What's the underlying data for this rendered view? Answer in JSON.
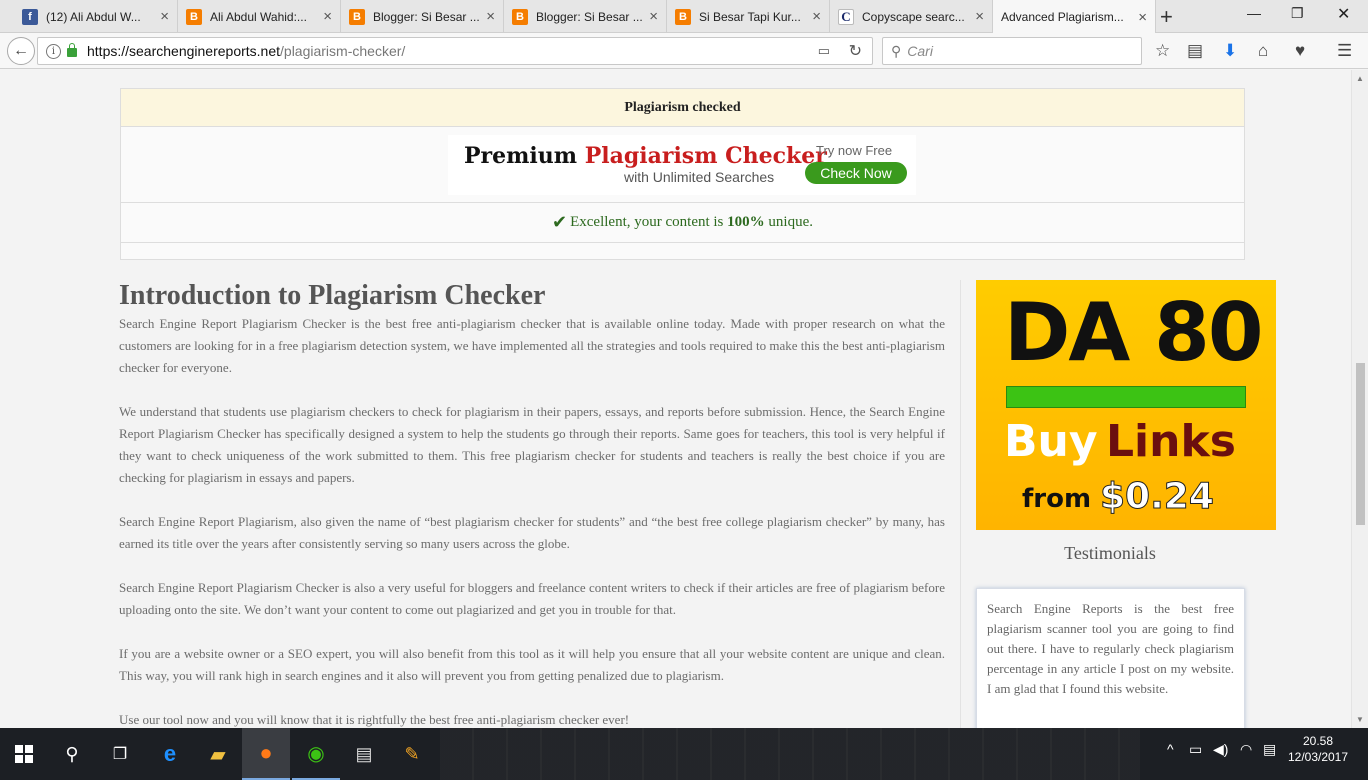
{
  "browser": {
    "tabs": [
      {
        "title": "(12) Ali Abdul W...",
        "favicon": "facebook-icon",
        "active": false
      },
      {
        "title": "Ali Abdul Wahid:...",
        "favicon": "blogger-icon",
        "active": false
      },
      {
        "title": "Blogger: Si Besar ...",
        "favicon": "blogger-icon",
        "active": false
      },
      {
        "title": "Blogger: Si Besar ...",
        "favicon": "blogger-icon",
        "active": false
      },
      {
        "title": "Si Besar Tapi Kur...",
        "favicon": "blogger-icon",
        "active": false
      },
      {
        "title": "Copyscape searc...",
        "favicon": "copyscape-icon",
        "active": false
      },
      {
        "title": "Advanced Plagiarism...",
        "favicon": "",
        "active": true
      }
    ],
    "url_host": "https://searchenginereports.net",
    "url_path": "/plagiarism-checker/",
    "search_placeholder": "Cari"
  },
  "result": {
    "header": "Plagiarism checked",
    "premium_ad": {
      "line1_a": "Premium ",
      "line1_b": "Plagiarism Checker",
      "line2": "with Unlimited Searches",
      "try_text": "Try now Free",
      "button": "Check Now"
    },
    "unique_prefix": "Excellent, your content is ",
    "unique_value": "100%",
    "unique_suffix": " unique."
  },
  "intro": {
    "title": "Introduction to Plagiarism Checker",
    "paragraphs": [
      "Search Engine Report Plagiarism Checker is the best free anti-plagiarism checker that is available online today. Made with proper research on what the customers are looking for in a free plagiarism detection system, we have implemented all the strategies and tools required to make this the best anti-plagiarism checker for everyone.",
      "We understand that students use plagiarism checkers to check for plagiarism in their papers, essays, and reports before submission. Hence, the Search Engine Report Plagiarism Checker has specifically designed a system to help the students go through their reports. Same goes for teachers, this tool is very helpful if they want to check uniqueness of the work submitted to them. This free plagiarism checker for students and teachers is really the best choice if you are checking for plagiarism in essays and papers.",
      "Search Engine Report Plagiarism, also given the name of “best plagiarism checker for students” and “the best free college plagiarism checker” by many, has earned its title over the years after consistently serving so many users across the globe.",
      "Search Engine Report Plagiarism Checker is also a very useful for bloggers and freelance content writers to check if their articles are free of plagiarism before uploading onto the site. We don’t want your content to come out plagiarized and get you in trouble for that.",
      "If you are a website owner or a SEO expert, you will also benefit from this tool as it will help you ensure that all your website content are unique and clean. This way, you will rank high in search engines and it also will prevent you from getting penalized due to plagiarism.",
      "Use our tool now and you will know that it is rightfully the best free anti-plagiarism checker ever!"
    ]
  },
  "sidebar": {
    "ad": {
      "da": "DA 80",
      "buy": "Buy",
      "links": "Links",
      "from": "from",
      "price": "$0.24"
    },
    "testimonials_title": "Testimonials",
    "testimonial_text": "Search Engine Reports is the best free plagiarism scanner tool you are going to find out there. I have to regularly check plagiarism percentage in any article I post on my website. I am glad that I found this website."
  },
  "taskbar": {
    "time": "20.58",
    "date": "12/03/2017"
  },
  "colors": {
    "result_header_bg": "#fcf6de",
    "success_green": "#2d6a1f",
    "ad_yellow": "#ffcc00",
    "check_now_green": "#3a9a1d"
  }
}
